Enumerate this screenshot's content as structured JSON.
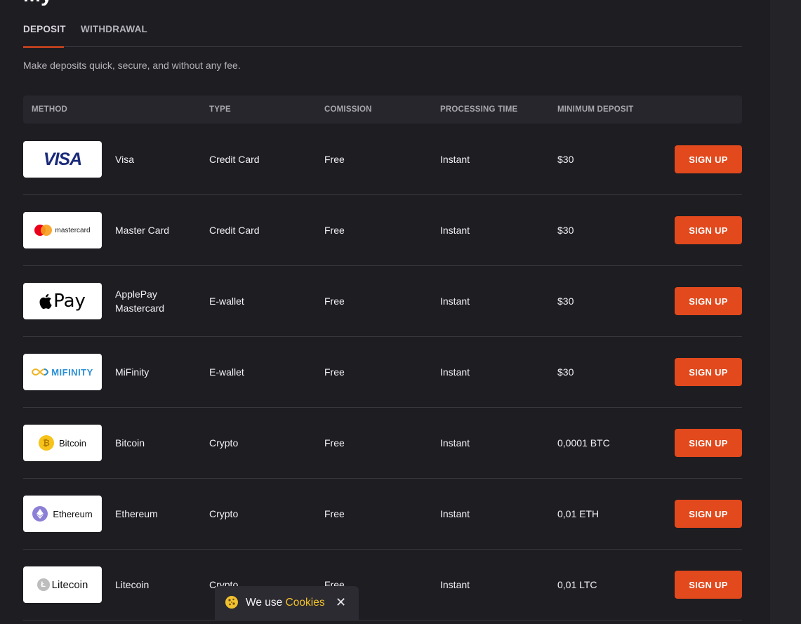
{
  "heading_partial": "My",
  "tabs": [
    {
      "label": "DEPOSIT",
      "active": true
    },
    {
      "label": "WITHDRAWAL",
      "active": false
    }
  ],
  "intro": "Make deposits quick, secure, and without any fee.",
  "columns": [
    "METHOD",
    "TYPE",
    "COMISSION",
    "PROCESSING TIME",
    "MINIMUM DEPOSIT"
  ],
  "rows": [
    {
      "logo": "VISA",
      "method": "Visa",
      "type": "Credit Card",
      "commission": "Free",
      "processing": "Instant",
      "minimum": "$30",
      "button": "SIGN UP"
    },
    {
      "logo": "mastercard",
      "method": "Master Card",
      "type": "Credit Card",
      "commission": "Free",
      "processing": "Instant",
      "minimum": "$30",
      "button": "SIGN UP"
    },
    {
      "logo": "Pay",
      "method": "ApplePay Mastercard",
      "type": "E-wallet",
      "commission": "Free",
      "processing": "Instant",
      "minimum": "$30",
      "button": "SIGN UP"
    },
    {
      "logo": "MIFINITY",
      "method": "MiFinity",
      "type": "E-wallet",
      "commission": "Free",
      "processing": "Instant",
      "minimum": "$30",
      "button": "SIGN UP"
    },
    {
      "logo": "Bitcoin",
      "method": "Bitcoin",
      "type": "Crypto",
      "commission": "Free",
      "processing": "Instant",
      "minimum": "0,0001 BTC",
      "button": "SIGN UP"
    },
    {
      "logo": "Ethereum",
      "method": "Ethereum",
      "type": "Crypto",
      "commission": "Free",
      "processing": "Instant",
      "minimum": "0,01 ETH",
      "button": "SIGN UP"
    },
    {
      "logo": "Litecoin",
      "method": "Litecoin",
      "type": "Crypto",
      "commission": "Free",
      "processing": "Instant",
      "minimum": "0,01 LTC",
      "button": "SIGN UP"
    }
  ],
  "cookie": {
    "text": "We use",
    "link": "Cookies",
    "close": "✕"
  },
  "colors": {
    "accent": "#e2491d",
    "background": "#1e1d22",
    "cookie_link": "#f0c02e"
  }
}
